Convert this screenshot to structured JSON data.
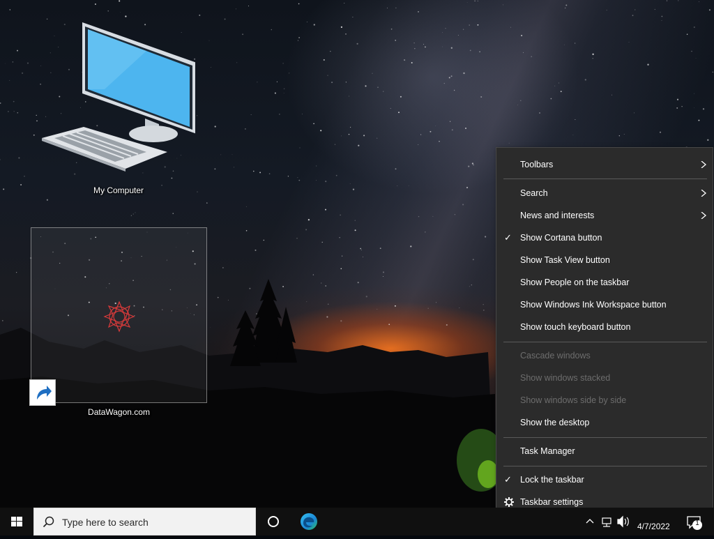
{
  "desktop": {
    "icons": [
      {
        "label": "My Computer"
      },
      {
        "label": "DataWagon.com"
      }
    ]
  },
  "context_menu": {
    "items": [
      {
        "label": "Toolbars",
        "submenu": true
      },
      {
        "label": "Search",
        "submenu": true
      },
      {
        "label": "News and interests",
        "submenu": true
      },
      {
        "label": "Show Cortana button",
        "checked": true
      },
      {
        "label": "Show Task View button"
      },
      {
        "label": "Show People on the taskbar"
      },
      {
        "label": "Show Windows Ink Workspace button"
      },
      {
        "label": "Show touch keyboard button"
      },
      {
        "label": "Cascade windows",
        "disabled": true
      },
      {
        "label": "Show windows stacked",
        "disabled": true
      },
      {
        "label": "Show windows side by side",
        "disabled": true
      },
      {
        "label": "Show the desktop"
      },
      {
        "label": "Task Manager"
      },
      {
        "label": "Lock the taskbar",
        "checked": true
      },
      {
        "label": "Taskbar settings",
        "icon": "gear-icon"
      }
    ]
  },
  "taskbar": {
    "search_placeholder": "Type here to search",
    "date": "4/7/2022",
    "notification_count": "1"
  },
  "colors": {
    "menu_bg": "#2b2b2b",
    "menu_disabled_text": "#6d6d6d",
    "taskbar_bg": "#101010",
    "accent_blue": "#0078d7"
  }
}
